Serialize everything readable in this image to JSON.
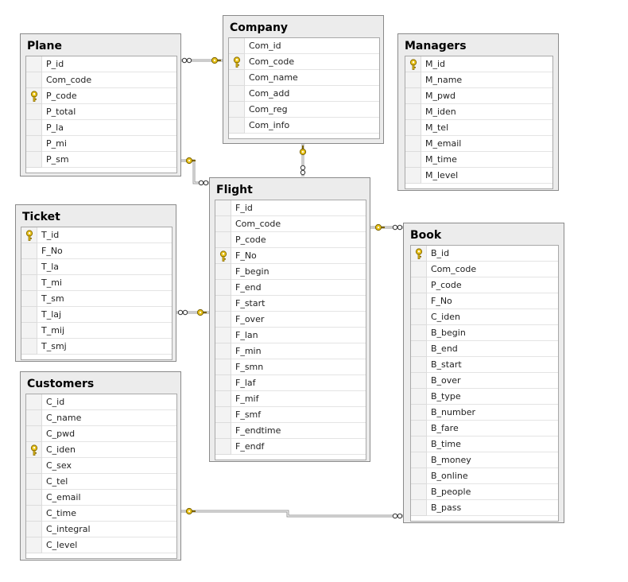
{
  "tables": [
    {
      "id": "plane",
      "title": "Plane",
      "columns": [
        {
          "name": "P_id",
          "pk": false
        },
        {
          "name": "Com_code",
          "pk": false
        },
        {
          "name": "P_code",
          "pk": true
        },
        {
          "name": "P_total",
          "pk": false
        },
        {
          "name": "P_la",
          "pk": false
        },
        {
          "name": "P_mi",
          "pk": false
        },
        {
          "name": "P_sm",
          "pk": false
        }
      ]
    },
    {
      "id": "company",
      "title": "Company",
      "columns": [
        {
          "name": "Com_id",
          "pk": false
        },
        {
          "name": "Com_code",
          "pk": true
        },
        {
          "name": "Com_name",
          "pk": false
        },
        {
          "name": "Com_add",
          "pk": false
        },
        {
          "name": "Com_reg",
          "pk": false
        },
        {
          "name": "Com_info",
          "pk": false
        }
      ]
    },
    {
      "id": "managers",
      "title": "Managers",
      "columns": [
        {
          "name": "M_id",
          "pk": true
        },
        {
          "name": "M_name",
          "pk": false
        },
        {
          "name": "M_pwd",
          "pk": false
        },
        {
          "name": "M_iden",
          "pk": false
        },
        {
          "name": "M_tel",
          "pk": false
        },
        {
          "name": "M_email",
          "pk": false
        },
        {
          "name": "M_time",
          "pk": false
        },
        {
          "name": "M_level",
          "pk": false
        }
      ]
    },
    {
      "id": "ticket",
      "title": "Ticket",
      "columns": [
        {
          "name": "T_id",
          "pk": true
        },
        {
          "name": "F_No",
          "pk": false
        },
        {
          "name": "T_la",
          "pk": false
        },
        {
          "name": "T_mi",
          "pk": false
        },
        {
          "name": "T_sm",
          "pk": false
        },
        {
          "name": "T_laj",
          "pk": false
        },
        {
          "name": "T_mij",
          "pk": false
        },
        {
          "name": "T_smj",
          "pk": false
        }
      ]
    },
    {
      "id": "flight",
      "title": "Flight",
      "columns": [
        {
          "name": "F_id",
          "pk": false
        },
        {
          "name": "Com_code",
          "pk": false
        },
        {
          "name": "P_code",
          "pk": false
        },
        {
          "name": "F_No",
          "pk": true
        },
        {
          "name": "F_begin",
          "pk": false
        },
        {
          "name": "F_end",
          "pk": false
        },
        {
          "name": "F_start",
          "pk": false
        },
        {
          "name": "F_over",
          "pk": false
        },
        {
          "name": "F_lan",
          "pk": false
        },
        {
          "name": "F_min",
          "pk": false
        },
        {
          "name": "F_smn",
          "pk": false
        },
        {
          "name": "F_laf",
          "pk": false
        },
        {
          "name": "F_mif",
          "pk": false
        },
        {
          "name": "F_smf",
          "pk": false
        },
        {
          "name": "F_endtime",
          "pk": false
        },
        {
          "name": "F_endf",
          "pk": false
        }
      ]
    },
    {
      "id": "book",
      "title": "Book",
      "columns": [
        {
          "name": "B_id",
          "pk": true
        },
        {
          "name": "Com_code",
          "pk": false
        },
        {
          "name": "P_code",
          "pk": false
        },
        {
          "name": "F_No",
          "pk": false
        },
        {
          "name": "C_iden",
          "pk": false
        },
        {
          "name": "B_begin",
          "pk": false
        },
        {
          "name": "B_end",
          "pk": false
        },
        {
          "name": "B_start",
          "pk": false
        },
        {
          "name": "B_over",
          "pk": false
        },
        {
          "name": "B_type",
          "pk": false
        },
        {
          "name": "B_number",
          "pk": false
        },
        {
          "name": "B_fare",
          "pk": false
        },
        {
          "name": "B_time",
          "pk": false
        },
        {
          "name": "B_money",
          "pk": false
        },
        {
          "name": "B_online",
          "pk": false
        },
        {
          "name": "B_people",
          "pk": false
        },
        {
          "name": "B_pass",
          "pk": false
        }
      ]
    },
    {
      "id": "customers",
      "title": "Customers",
      "columns": [
        {
          "name": "C_id",
          "pk": false
        },
        {
          "name": "C_name",
          "pk": false
        },
        {
          "name": "C_pwd",
          "pk": false
        },
        {
          "name": "C_iden",
          "pk": true
        },
        {
          "name": "C_sex",
          "pk": false
        },
        {
          "name": "C_tel",
          "pk": false
        },
        {
          "name": "C_email",
          "pk": false
        },
        {
          "name": "C_time",
          "pk": false
        },
        {
          "name": "C_integral",
          "pk": false
        },
        {
          "name": "C_level",
          "pk": false
        }
      ]
    }
  ],
  "relationships": [
    {
      "from": "plane",
      "to": "company"
    },
    {
      "from": "flight",
      "to": "company"
    },
    {
      "from": "flight",
      "to": "plane"
    },
    {
      "from": "ticket",
      "to": "flight"
    },
    {
      "from": "book",
      "to": "flight"
    },
    {
      "from": "book",
      "to": "customers"
    }
  ],
  "colors": {
    "key": "#e8c21a",
    "line": "#555555",
    "panel": "#ececec"
  }
}
